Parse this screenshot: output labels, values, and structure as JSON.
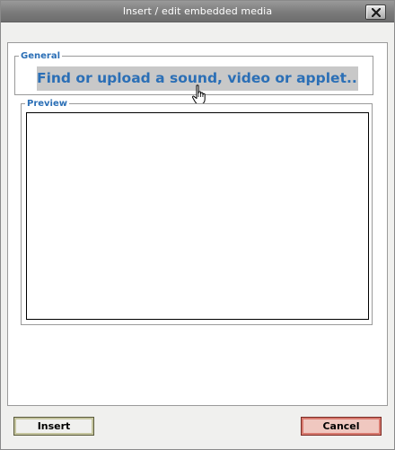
{
  "window": {
    "title": "Insert / edit embedded media"
  },
  "icons": {
    "close": "close-icon",
    "cursor": "hand-pointer-icon"
  },
  "general": {
    "legend": "General",
    "browse_link": "Find or upload a sound, video or applet..."
  },
  "preview": {
    "legend": "Preview"
  },
  "buttons": {
    "insert": "Insert",
    "cancel": "Cancel"
  },
  "colors": {
    "accent_link": "#2b6fb6",
    "titlebar": "#7b7b7b",
    "cancel_bg": "#f0c8c0"
  }
}
